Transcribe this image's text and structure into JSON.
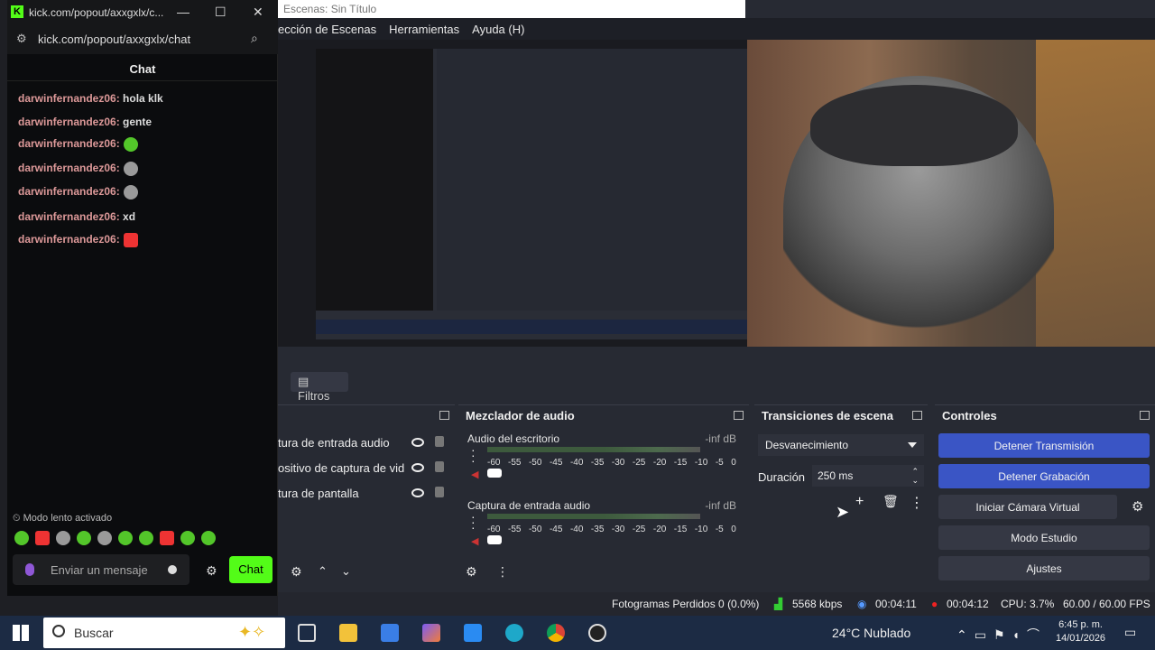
{
  "kick": {
    "window_title": "kick.com/popout/axxgxlx/c...",
    "url": "kick.com/popout/axxgxlx/chat",
    "chat_header": "Chat",
    "messages": [
      {
        "user": "darwinfernandez06:",
        "text": "hola klk",
        "emote": ""
      },
      {
        "user": "darwinfernandez06:",
        "text": "gente",
        "emote": ""
      },
      {
        "user": "darwinfernandez06:",
        "text": "",
        "emote": "green"
      },
      {
        "user": "darwinfernandez06:",
        "text": "",
        "emote": "gray"
      },
      {
        "user": "darwinfernandez06:",
        "text": "",
        "emote": "gray"
      },
      {
        "user": "darwinfernandez06:",
        "text": "xd",
        "emote": ""
      },
      {
        "user": "darwinfernandez06:",
        "text": "",
        "emote": "red"
      }
    ],
    "slow_mode": "Modo lento activado",
    "input_placeholder": "Enviar un mensaje",
    "send_label": "Chat"
  },
  "obs": {
    "window_title": "Escenas: Sin Título",
    "menu": [
      "ección de Escenas",
      "Herramientas",
      "Ayuda (H)"
    ],
    "filters_label": "Filtros",
    "sources": [
      "tura de entrada audio",
      "ositivo de captura de vid",
      "tura de pantalla"
    ],
    "mixer_title": "Mezclador de audio",
    "channels": [
      {
        "name": "Audio del escritorio",
        "db": "-inf dB"
      },
      {
        "name": "Captura de entrada audio",
        "db": "-inf dB"
      }
    ],
    "meter_scale": [
      "-60",
      "-55",
      "-50",
      "-45",
      "-40",
      "-35",
      "-30",
      "-25",
      "-20",
      "-15",
      "-10",
      "-5",
      "0"
    ],
    "transitions_title": "Transiciones de escena",
    "transition_selected": "Desvanecimiento",
    "duration_label": "Duración",
    "duration_value": "250 ms",
    "controls_title": "Controles",
    "controls": [
      "Detener Transmisión",
      "Detener Grabación",
      "Iniciar Cámara Virtual",
      "Modo Estudio",
      "Ajustes"
    ],
    "status": {
      "dropped": "Fotogramas Perdidos 0 (0.0%)",
      "bitrate": "5568 kbps",
      "stream_time": "00:04:11",
      "rec_time": "00:04:12",
      "cpu": "CPU: 3.7%",
      "fps": "60.00 / 60.00 FPS"
    }
  },
  "taskbar": {
    "search_placeholder": "Buscar",
    "weather": "24°C  Nublado",
    "time": "6:45 p. m.",
    "date": "14/01/2026"
  }
}
